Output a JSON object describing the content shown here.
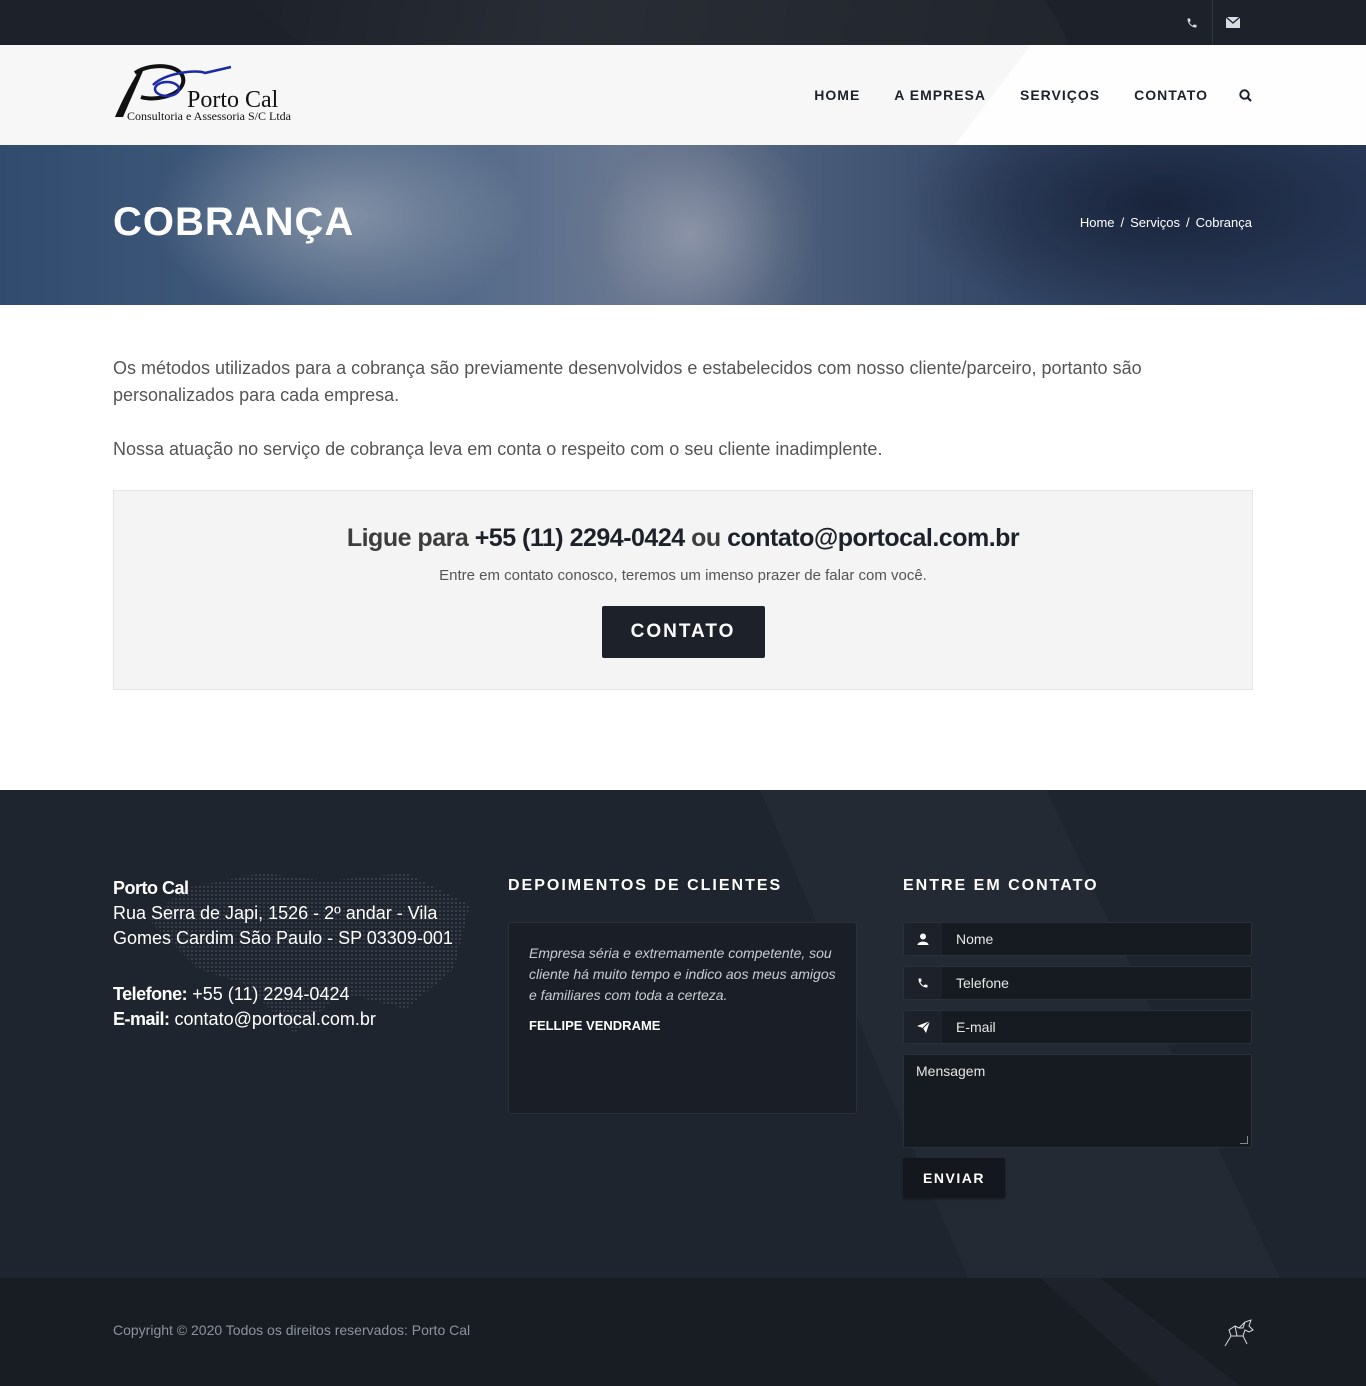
{
  "topbar": {
    "icons": [
      "phone-icon",
      "envelope-icon"
    ]
  },
  "logo": {
    "name": "Porto Cal",
    "tagline": "Consultoria e Assessoria S/C Ltda"
  },
  "nav": {
    "items": [
      "HOME",
      "A EMPRESA",
      "SERVIÇOS",
      "CONTATO"
    ],
    "search_icon": "search-icon"
  },
  "page": {
    "title": "COBRANÇA",
    "breadcrumb": [
      "Home",
      "/",
      "Serviços",
      "/",
      "Cobrança"
    ]
  },
  "content": {
    "paragraphs": [
      "Os métodos utilizados para a cobrança são previamente desenvolvidos e estabelecidos com nosso cliente/parceiro, portanto são personalizados para cada empresa.",
      "Nossa atuação no serviço de cobrança leva em conta o respeito com o seu cliente inadimplente."
    ]
  },
  "cta": {
    "prefix": "Ligue para ",
    "phone": "+55 (11) 2294-0424",
    "middle": " ou ",
    "email": "contato@portocal.com.br",
    "subtitle": "Entre em contato conosco, teremos um imenso prazer de falar com você.",
    "button": "CONTATO"
  },
  "footer": {
    "company": "Porto Cal",
    "address": "Rua Serra de Japi, 1526 - 2º andar - Vila Gomes Cardim São Paulo - SP 03309-001",
    "phone_label": "Telefone:",
    "phone": "+55 (11) 2294-0424",
    "email_label": "E-mail:",
    "email": "contato@portocal.com.br",
    "testimonials_heading": "DEPOIMENTOS DE CLIENTES",
    "testimonial_quote": "Empresa séria e extremamente competente, sou cliente há muito tempo e indico aos meus amigos e familiares com toda a certeza.",
    "testimonial_author": "FELLIPE VENDRAME",
    "contact_heading": "ENTRE EM CONTATO",
    "form": {
      "name_placeholder": "Nome",
      "phone_placeholder": "Telefone",
      "email_placeholder": "E-mail",
      "message_placeholder": "Mensagem",
      "submit": "ENVIAR"
    },
    "copyright": "Copyright © 2020 Todos os direitos reservados: Porto Cal"
  }
}
